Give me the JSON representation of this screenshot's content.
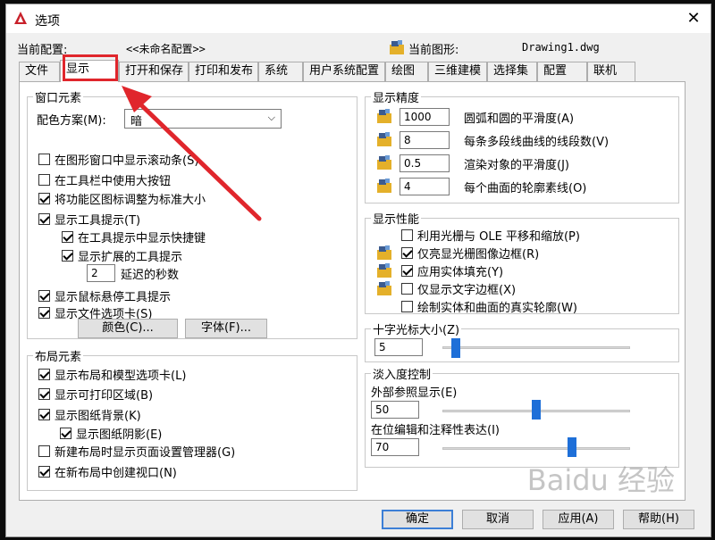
{
  "window": {
    "title": "选项",
    "close_label": "✕"
  },
  "header": {
    "profile_label": "当前配置:",
    "profile_value": "<<未命名配置>>",
    "drawing_label": "当前图形:",
    "drawing_value": "Drawing1.dwg"
  },
  "tabs": [
    "文件",
    "显示",
    "打开和保存",
    "打印和发布",
    "系统",
    "用户系统配置",
    "绘图",
    "三维建模",
    "选择集",
    "配置",
    "联机"
  ],
  "window_elements": {
    "title": "窗口元素",
    "color_scheme_label": "配色方案(M):",
    "color_scheme_value": "暗",
    "options": [
      {
        "label": "在图形窗口中显示滚动条(S)",
        "checked": false
      },
      {
        "label": "在工具栏中使用大按钮",
        "checked": false
      },
      {
        "label": "将功能区图标调整为标准大小",
        "checked": true
      },
      {
        "label": "显示工具提示(T)",
        "checked": true
      },
      {
        "label": "在工具提示中显示快捷键",
        "checked": true
      },
      {
        "label": "显示扩展的工具提示",
        "checked": true
      },
      {
        "label": "显示鼠标悬停工具提示",
        "checked": true
      },
      {
        "label": "显示文件选项卡(S)",
        "checked": true
      }
    ],
    "delay_value": "2",
    "delay_label": "延迟的秒数",
    "colors_button": "颜色(C)...",
    "fonts_button": "字体(F)..."
  },
  "layout_elements": {
    "title": "布局元素",
    "options": [
      {
        "label": "显示布局和模型选项卡(L)",
        "checked": true
      },
      {
        "label": "显示可打印区域(B)",
        "checked": true
      },
      {
        "label": "显示图纸背景(K)",
        "checked": true
      },
      {
        "label": "显示图纸阴影(E)",
        "checked": true
      },
      {
        "label": "新建布局时显示页面设置管理器(G)",
        "checked": false
      },
      {
        "label": "在新布局中创建视口(N)",
        "checked": true
      }
    ]
  },
  "display_resolution": {
    "title": "显示精度",
    "rows": [
      {
        "value": "1000",
        "label": "圆弧和圆的平滑度(A)"
      },
      {
        "value": "8",
        "label": "每条多段线曲线的线段数(V)"
      },
      {
        "value": "0.5",
        "label": "渲染对象的平滑度(J)"
      },
      {
        "value": "4",
        "label": "每个曲面的轮廓素线(O)"
      }
    ]
  },
  "display_performance": {
    "title": "显示性能",
    "options": [
      {
        "label": "利用光栅与 OLE 平移和缩放(P)",
        "checked": false
      },
      {
        "label": "仅亮显光栅图像边框(R)",
        "checked": true
      },
      {
        "label": "应用实体填充(Y)",
        "checked": true
      },
      {
        "label": "仅显示文字边框(X)",
        "checked": false
      },
      {
        "label": "绘制实体和曲面的真实轮廓(W)",
        "checked": false
      }
    ]
  },
  "crosshair": {
    "title": "十字光标大小(Z)",
    "value": "5",
    "level_fraction": 0.05
  },
  "fade_control": {
    "title": "淡入度控制",
    "xref_label": "外部参照显示(E)",
    "xref_value": "50",
    "xref_fraction": 0.5,
    "inplace_label": "在位编辑和注释性表达(I)",
    "inplace_value": "70",
    "inplace_fraction": 0.7
  },
  "footer": {
    "ok": "确定",
    "cancel": "取消",
    "apply": "应用(A)",
    "help": "帮助(H)"
  },
  "watermark": "Baidu 经验",
  "colors": {
    "highlight": "#e0262c",
    "arrow": "#e0262c",
    "slider": "#1e6fd8",
    "default_button_border": "#3c7fd6"
  }
}
